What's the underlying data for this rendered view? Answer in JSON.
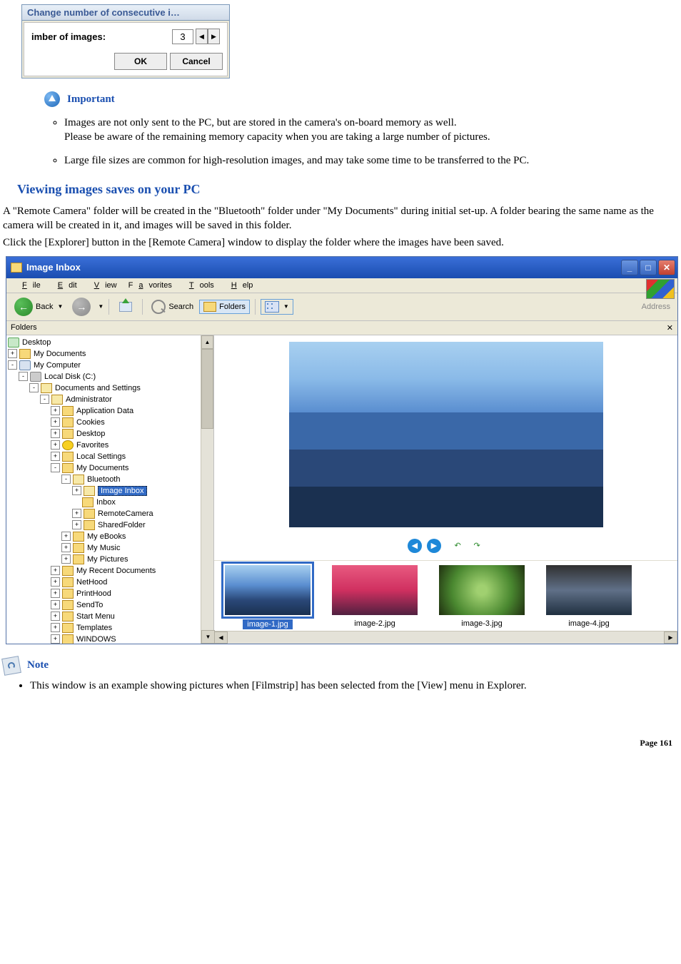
{
  "dialog": {
    "title": "Change number of consecutive i…",
    "label": "imber of images:",
    "value": "3",
    "ok": "OK",
    "cancel": "Cancel"
  },
  "important": {
    "heading": "Important",
    "item1_line1": "Images are not only sent to the PC, but are stored in the camera's on-board memory as well.",
    "item1_line2": "Please be aware of the remaining memory capacity when you are taking a large number of pictures.",
    "item2": "Large file sizes are common for high-resolution images, and may take some time to be transferred to the PC."
  },
  "section": {
    "heading": "Viewing images saves on your PC",
    "p1": "A \"Remote Camera\" folder will be created in the \"Bluetooth\" folder under \"My Documents\" during initial set-up. A folder bearing the same name as the camera will be created in it, and images will be saved in this folder.",
    "p2": "Click the [Explorer] button in the [Remote Camera] window to display the folder where the images have been saved."
  },
  "explorer": {
    "title": "Image Inbox",
    "menu": {
      "file": "File",
      "edit": "Edit",
      "view": "View",
      "favorites": "Favorites",
      "tools": "Tools",
      "help": "Help"
    },
    "toolbar": {
      "back": "Back",
      "search": "Search",
      "folders": "Folders",
      "address": "Address"
    },
    "folders_label": "Folders",
    "tree": {
      "desktop": "Desktop",
      "mydocs": "My Documents",
      "mycomp": "My Computer",
      "local": "Local Disk (C:)",
      "docset": "Documents and Settings",
      "admin": "Administrator",
      "appdata": "Application Data",
      "cookies": "Cookies",
      "desk": "Desktop",
      "fav": "Favorites",
      "locals": "Local Settings",
      "mydocs2": "My Documents",
      "bt": "Bluetooth",
      "imginbox": "Image Inbox",
      "inbox": "Inbox",
      "remcam": "RemoteCamera",
      "shared": "SharedFolder",
      "ebooks": "My eBooks",
      "music": "My Music",
      "pics": "My Pictures",
      "recent": "My Recent Documents",
      "nethood": "NetHood",
      "printhood": "PrintHood",
      "sendto": "SendTo",
      "startmenu": "Start Menu",
      "templates": "Templates",
      "windows": "WINDOWS"
    },
    "thumbs": {
      "i1": "image-1.jpg",
      "i2": "image-2.jpg",
      "i3": "image-3.jpg",
      "i4": "image-4.jpg"
    }
  },
  "note": {
    "heading": "Note",
    "item1": "This window is an example showing pictures when [Filmstrip] has been selected from the [View] menu in Explorer."
  },
  "page_number": "Page 161"
}
